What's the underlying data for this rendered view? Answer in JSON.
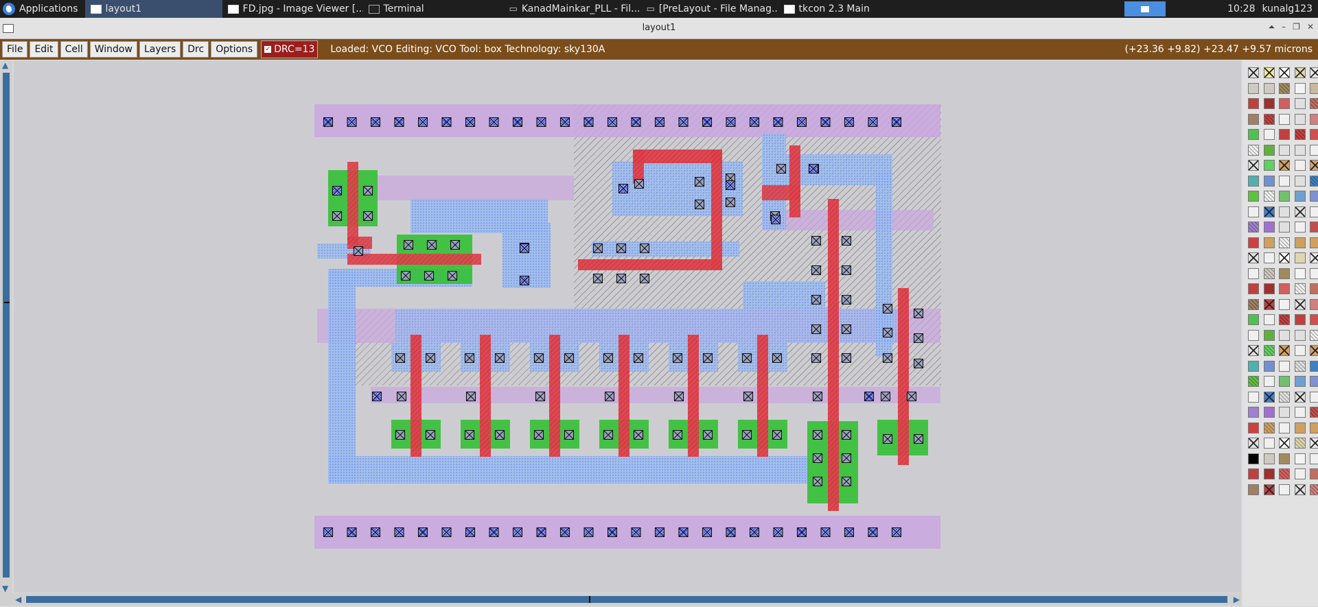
{
  "taskbar": {
    "apps_label": "Applications",
    "tasks": [
      {
        "label": "layout1",
        "icon": "window-icon",
        "active": true
      },
      {
        "label": "FD.jpg - Image Viewer [...",
        "icon": "window-icon",
        "active": false
      },
      {
        "label": "Terminal",
        "icon": "terminal-icon",
        "active": false
      },
      {
        "label": "KanadMainkar_PLL - Fil...",
        "icon": "folder-icon",
        "active": false
      },
      {
        "label": "[PreLayout - File Manag...",
        "icon": "folder-icon",
        "active": false
      },
      {
        "label": "tkcon 2.3 Main",
        "icon": "window-icon",
        "active": false
      }
    ],
    "clock": "10:28",
    "user": "kunalg123"
  },
  "window": {
    "title": "layout1"
  },
  "menubar": {
    "items": [
      "File",
      "Edit",
      "Cell",
      "Window",
      "Layers",
      "Drc",
      "Options"
    ],
    "drc_label": "DRC=13",
    "status": "Loaded: VCO  Editing: VCO  Tool: box   Technology: sky130A",
    "coords": "(+23.36 +9.82) +23.47 +9.57 microns"
  },
  "colors": {
    "menubar": "#7a4d1b",
    "poly": "#e0404a",
    "diff": "#34c034",
    "li": "#8fb0ea",
    "met1": "#c9a6e0",
    "nwell": "#222222",
    "canvas": "#cdcdd1"
  }
}
